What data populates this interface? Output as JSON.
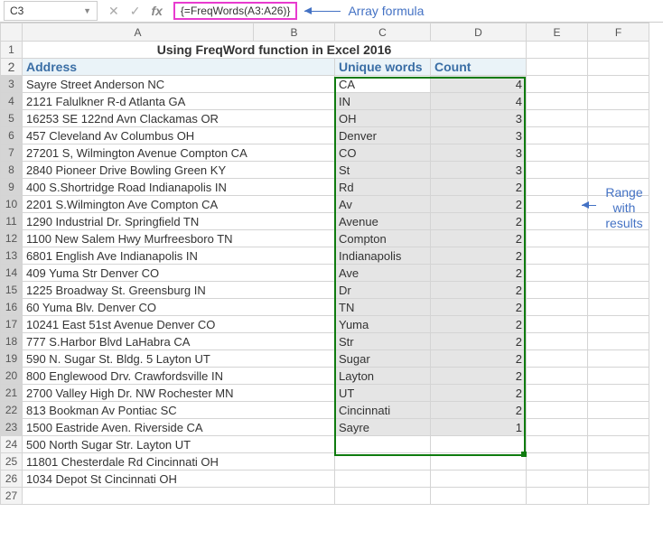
{
  "formula_bar": {
    "name_box": "C3",
    "formula": "{=FreqWords(A3:A26)}",
    "annotation": "Array formula"
  },
  "side_annotation": "Range\nwith\nresults",
  "columns": [
    "A",
    "B",
    "C",
    "D",
    "E",
    "F"
  ],
  "title": "Using FreqWord function in Excel 2016",
  "headers": {
    "address": "Address",
    "unique": "Unique words",
    "count": "Count"
  },
  "rows": [
    {
      "n": 3,
      "addr": "Sayre Street  Anderson  NC",
      "word": "CA",
      "cnt": 4,
      "sel": true
    },
    {
      "n": 4,
      "addr": "2121 Falulkner R-d  Atlanta  GA",
      "word": "IN",
      "cnt": 4
    },
    {
      "n": 5,
      "addr": "16253 SE 122nd Avn  Clackamas  OR",
      "word": "OH",
      "cnt": 3
    },
    {
      "n": 6,
      "addr": "457 Cleveland Av  Columbus  OH",
      "word": "Denver",
      "cnt": 3
    },
    {
      "n": 7,
      "addr": "27201 S, Wilmington Avenue  Compton  CA",
      "word": "CO",
      "cnt": 3
    },
    {
      "n": 8,
      "addr": "2840 Pioneer Drive  Bowling Green  KY",
      "word": "St",
      "cnt": 3
    },
    {
      "n": 9,
      "addr": "400 S.Shortridge Road  Indianapolis  IN",
      "word": "Rd",
      "cnt": 2
    },
    {
      "n": 10,
      "addr": "2201 S.Wilmington Ave  Compton  CA",
      "word": "Av",
      "cnt": 2
    },
    {
      "n": 11,
      "addr": "1290 Industrial Dr.  Springfield  TN",
      "word": "Avenue",
      "cnt": 2
    },
    {
      "n": 12,
      "addr": "1100 New Salem Hwy  Murfreesboro  TN",
      "word": "Compton",
      "cnt": 2
    },
    {
      "n": 13,
      "addr": "6801 English Ave  Indianapolis  IN",
      "word": "Indianapolis",
      "cnt": 2
    },
    {
      "n": 14,
      "addr": "409 Yuma Str  Denver  CO",
      "word": "Ave",
      "cnt": 2
    },
    {
      "n": 15,
      "addr": "1225  Broadway St.  Greensburg  IN",
      "word": "Dr",
      "cnt": 2
    },
    {
      "n": 16,
      "addr": "60 Yuma Blv.  Denver  CO",
      "word": "TN",
      "cnt": 2
    },
    {
      "n": 17,
      "addr": "10241 East 51st Avenue  Denver  CO",
      "word": "Yuma",
      "cnt": 2
    },
    {
      "n": 18,
      "addr": "777 S.Harbor Blvd  LaHabra  CA",
      "word": "Str",
      "cnt": 2
    },
    {
      "n": 19,
      "addr": "590 N. Sugar St. Bldg. 5  Layton  UT",
      "word": "Sugar",
      "cnt": 2
    },
    {
      "n": 20,
      "addr": "800 Englewood Drv.  Crawfordsville  IN",
      "word": "Layton",
      "cnt": 2
    },
    {
      "n": 21,
      "addr": "2700 Valley High Dr. NW  Rochester  MN",
      "word": "UT",
      "cnt": 2
    },
    {
      "n": 22,
      "addr": "813 Bookman Av  Pontiac  SC",
      "word": "Cincinnati",
      "cnt": 2
    },
    {
      "n": 23,
      "addr": "1500 Eastride Aven.  Riverside  CA",
      "word": "Sayre",
      "cnt": 1
    },
    {
      "n": 24,
      "addr": "500 North Sugar Str.  Layton  UT",
      "word": "",
      "cnt": ""
    },
    {
      "n": 25,
      "addr": "11801 Chesterdale Rd  Cincinnati  OH",
      "word": "",
      "cnt": ""
    },
    {
      "n": 26,
      "addr": "1034 Depot St  Cincinnati  OH",
      "word": "",
      "cnt": ""
    },
    {
      "n": 27,
      "addr": "",
      "word": "",
      "cnt": ""
    }
  ],
  "chart_data": {
    "type": "table",
    "title": "Using FreqWord function in Excel 2016",
    "columns": [
      "Address",
      "Unique words",
      "Count"
    ],
    "addresses": [
      "Sayre Street  Anderson  NC",
      "2121 Falulkner R-d  Atlanta  GA",
      "16253 SE 122nd Avn  Clackamas  OR",
      "457 Cleveland Av  Columbus  OH",
      "27201 S, Wilmington Avenue  Compton  CA",
      "2840 Pioneer Drive  Bowling Green  KY",
      "400 S.Shortridge Road  Indianapolis  IN",
      "2201 S.Wilmington Ave  Compton  CA",
      "1290 Industrial Dr.  Springfield  TN",
      "1100 New Salem Hwy  Murfreesboro  TN",
      "6801 English Ave  Indianapolis  IN",
      "409 Yuma Str  Denver  CO",
      "1225  Broadway St.  Greensburg  IN",
      "60 Yuma Blv.  Denver  CO",
      "10241 East 51st Avenue  Denver  CO",
      "777 S.Harbor Blvd  LaHabra  CA",
      "590 N. Sugar St. Bldg. 5  Layton  UT",
      "800 Englewood Drv.  Crawfordsville  IN",
      "2700 Valley High Dr. NW  Rochester  MN",
      "813 Bookman Av  Pontiac  SC",
      "1500 Eastride Aven.  Riverside  CA",
      "500 North Sugar Str.  Layton  UT",
      "11801 Chesterdale Rd  Cincinnati  OH",
      "1034 Depot St  Cincinnati  OH"
    ],
    "results": [
      {
        "word": "CA",
        "count": 4
      },
      {
        "word": "IN",
        "count": 4
      },
      {
        "word": "OH",
        "count": 3
      },
      {
        "word": "Denver",
        "count": 3
      },
      {
        "word": "CO",
        "count": 3
      },
      {
        "word": "St",
        "count": 3
      },
      {
        "word": "Rd",
        "count": 2
      },
      {
        "word": "Av",
        "count": 2
      },
      {
        "word": "Avenue",
        "count": 2
      },
      {
        "word": "Compton",
        "count": 2
      },
      {
        "word": "Indianapolis",
        "count": 2
      },
      {
        "word": "Ave",
        "count": 2
      },
      {
        "word": "Dr",
        "count": 2
      },
      {
        "word": "TN",
        "count": 2
      },
      {
        "word": "Yuma",
        "count": 2
      },
      {
        "word": "Str",
        "count": 2
      },
      {
        "word": "Sugar",
        "count": 2
      },
      {
        "word": "Layton",
        "count": 2
      },
      {
        "word": "UT",
        "count": 2
      },
      {
        "word": "Cincinnati",
        "count": 2
      },
      {
        "word": "Sayre",
        "count": 1
      }
    ]
  }
}
